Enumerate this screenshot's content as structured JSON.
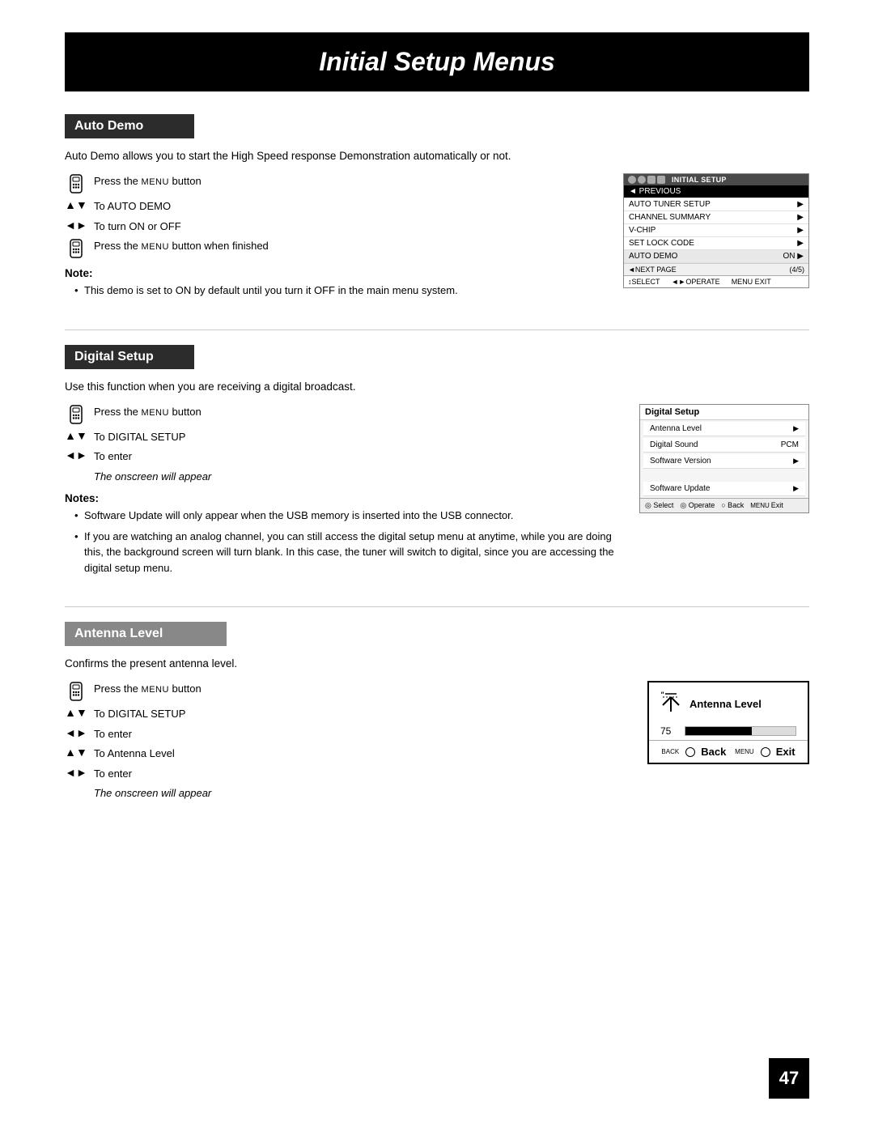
{
  "page": {
    "title": "Initial Setup Menus",
    "page_number": "47"
  },
  "sections": {
    "auto_demo": {
      "header": "Auto Demo",
      "description": "Auto Demo allows you to start the High Speed response Demonstration automatically or not.",
      "steps": [
        {
          "icon": "remote",
          "text": "Press the MENU button"
        },
        {
          "icon": "arrow-ud",
          "text": "To AUTO DEMO"
        },
        {
          "icon": "arrow-lr",
          "text": "To turn ON or OFF"
        },
        {
          "icon": "remote",
          "text": "Press the MENU button when finished"
        }
      ],
      "note_title": "Note:",
      "notes": [
        "This demo is set to ON by default until you turn it OFF in the main menu system."
      ],
      "screen": {
        "header_icons": [
          "icon1",
          "icon2",
          "icon3",
          "icon4"
        ],
        "title": "INITIAL SETUP",
        "items": [
          {
            "label": "◄ PREVIOUS",
            "value": "",
            "highlighted": false
          },
          {
            "label": "AUTO TUNER SETUP",
            "value": "▶",
            "highlighted": false
          },
          {
            "label": "CHANNEL SUMMARY",
            "value": "▶",
            "highlighted": false
          },
          {
            "label": "V-CHIP",
            "value": "▶",
            "highlighted": false
          },
          {
            "label": "SET LOCK CODE",
            "value": "▶",
            "highlighted": false
          },
          {
            "label": "AUTO DEMO",
            "value": "ON ▶",
            "highlighted": true
          }
        ],
        "next_page": "◄NEXT PAGE",
        "page_count": "(4/5)",
        "footer": [
          {
            "key": "↕SELECT"
          },
          {
            "key": "◄►OPERATE"
          },
          {
            "key": "MENU EXIT"
          }
        ]
      }
    },
    "digital_setup": {
      "header": "Digital Setup",
      "description": "Use this function when you are receiving a digital broadcast.",
      "steps": [
        {
          "icon": "remote",
          "text": "Press the MENU button"
        },
        {
          "icon": "arrow-ud",
          "text": "To DIGITAL SETUP"
        },
        {
          "icon": "arrow-lr",
          "text": "To enter"
        },
        {
          "icon": "italic",
          "text": "The onscreen will appear"
        }
      ],
      "notes_title": "Notes:",
      "notes": [
        "Software Update will only appear when the USB memory is inserted into the USB connector.",
        "If you are watching an analog channel, you can still access the digital setup menu at anytime, while you are doing this, the background screen will turn blank. In this case, the tuner will switch to digital, since you are accessing the digital setup menu."
      ],
      "screen": {
        "title": "Digital Setup",
        "items": [
          {
            "label": "Antenna Level",
            "value": "▶"
          },
          {
            "label": "Digital Sound",
            "value": "PCM"
          },
          {
            "label": "Software Version",
            "value": "▶"
          }
        ],
        "spacer": true,
        "extra_items": [
          {
            "label": "Software Update",
            "value": "▶"
          }
        ],
        "footer": [
          {
            "icon": "◎",
            "label": "Select"
          },
          {
            "icon": "◎",
            "label": "Operate"
          },
          {
            "icon": "○",
            "label": "Back"
          },
          {
            "icon": "MENU",
            "label": "Exit"
          }
        ]
      }
    },
    "antenna_level": {
      "header": "Antenna Level",
      "description": "Confirms the present antenna level.",
      "steps": [
        {
          "icon": "remote",
          "text": "Press the MENU button"
        },
        {
          "icon": "arrow-ud",
          "text": "To DIGITAL SETUP"
        },
        {
          "icon": "arrow-lr",
          "text": "To enter"
        },
        {
          "icon": "arrow-ud",
          "text": "To Antenna Level"
        },
        {
          "icon": "arrow-lr",
          "text": "To enter"
        },
        {
          "icon": "italic",
          "text": "The onscreen will appear"
        }
      ],
      "screen": {
        "antenna_icon": "Ȳ",
        "title": "Antenna Level",
        "level": "75",
        "bar_percent": 60,
        "back_label": "Back",
        "exit_label": "Exit",
        "back_key": "BACK",
        "exit_key": "MENU"
      }
    }
  }
}
